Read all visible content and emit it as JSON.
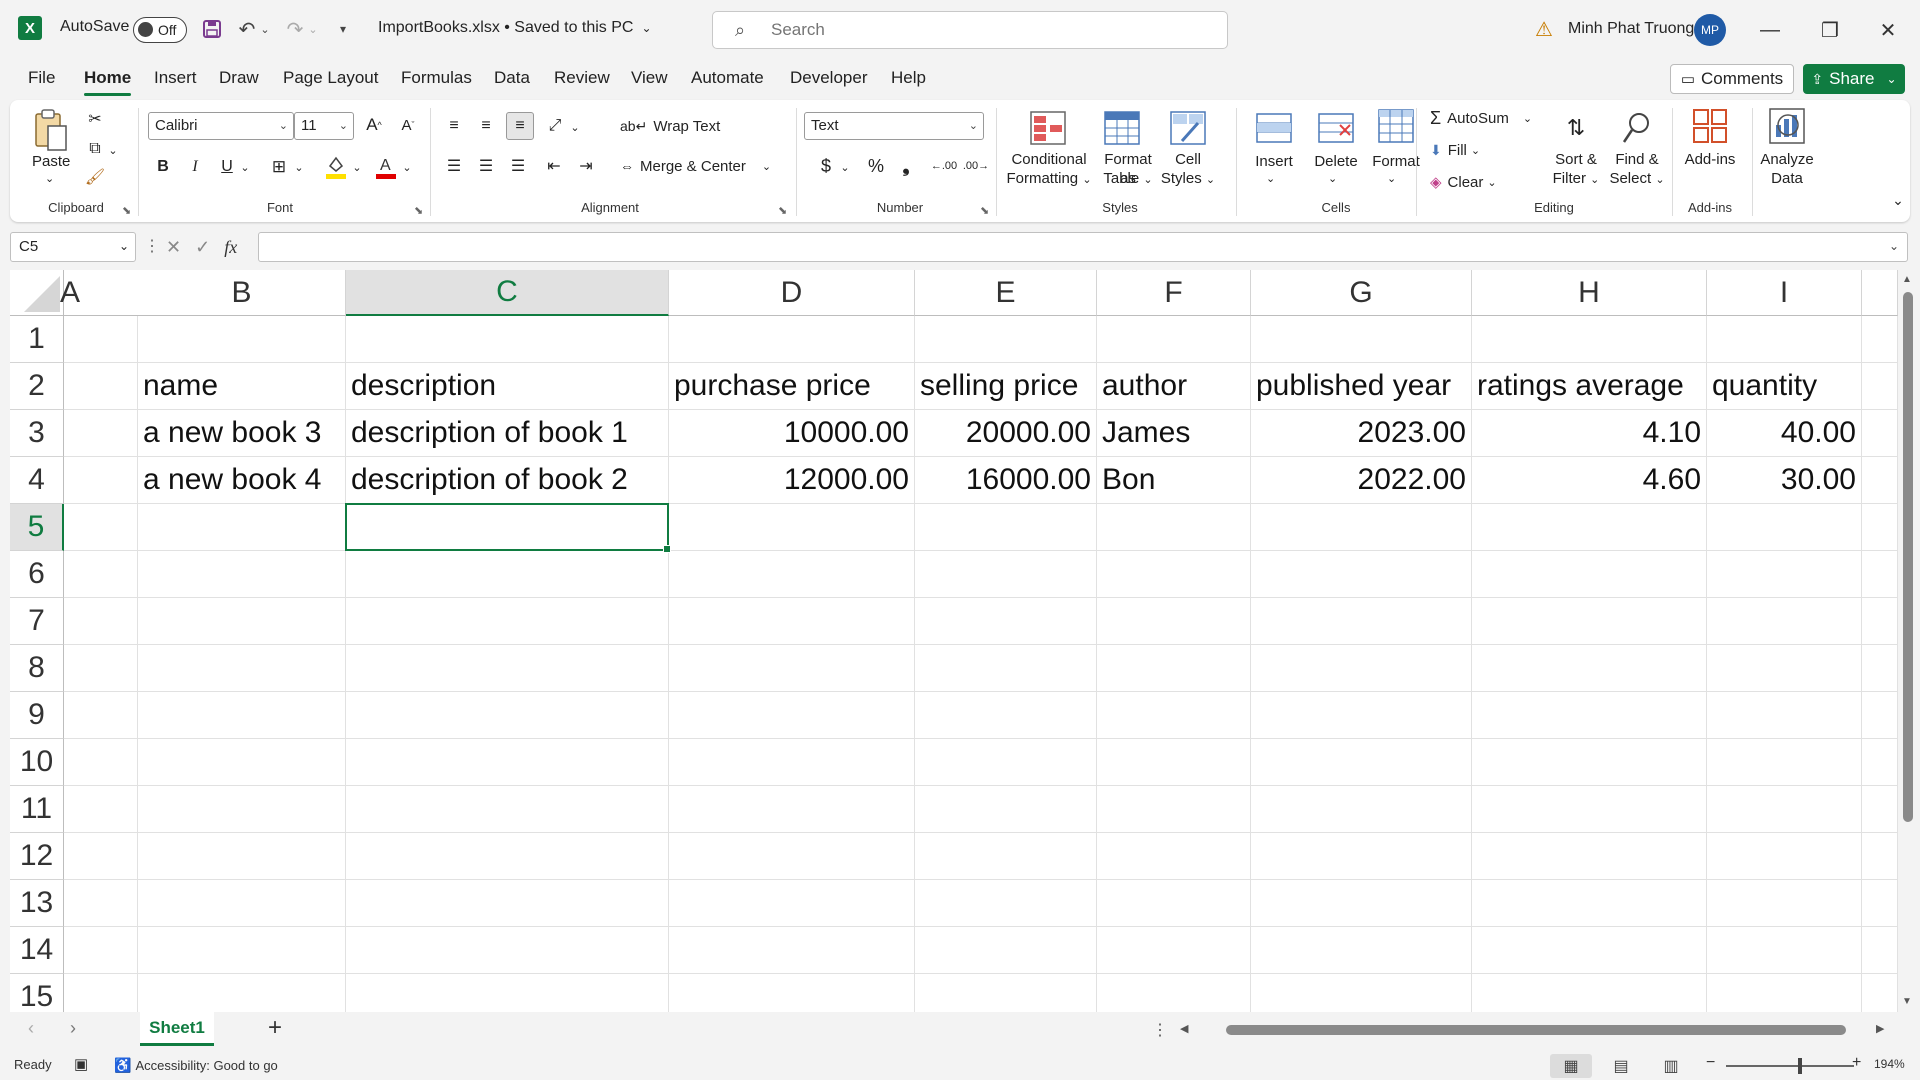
{
  "titlebar": {
    "autosave_label": "AutoSave",
    "autosave_state": "Off",
    "filename": "ImportBooks.xlsx • Saved to this PC",
    "search_placeholder": "Search",
    "user_name": "Minh Phat Truong",
    "user_initials": "MP"
  },
  "menu": {
    "tabs": [
      "File",
      "Home",
      "Insert",
      "Draw",
      "Page Layout",
      "Formulas",
      "Data",
      "Review",
      "View",
      "Automate",
      "Developer",
      "Help"
    ],
    "active": "Home",
    "comments": "Comments",
    "share": "Share"
  },
  "ribbon": {
    "groups": [
      "Clipboard",
      "Font",
      "Alignment",
      "Number",
      "Styles",
      "Cells",
      "Editing",
      "Add-ins"
    ],
    "paste": "Paste",
    "font_name": "Calibri",
    "font_size": "11",
    "wrap_text": "Wrap Text",
    "merge_center": "Merge & Center",
    "number_format": "Text",
    "conditional_formatting": [
      "Conditional",
      "Formatting"
    ],
    "format_as_table": [
      "Format as",
      "Table"
    ],
    "cell_styles": [
      "Cell",
      "Styles"
    ],
    "insert": "Insert",
    "delete": "Delete",
    "format": "Format",
    "autosum": "AutoSum",
    "fill": "Fill",
    "clear": "Clear",
    "sort_filter": [
      "Sort &",
      "Filter"
    ],
    "find_select": [
      "Find &",
      "Select"
    ],
    "addins": "Add-ins",
    "analyze_data": [
      "Analyze",
      "Data"
    ]
  },
  "formula_bar": {
    "name_box": "C5",
    "fx": "fx",
    "content": ""
  },
  "sheet": {
    "columns": [
      "A",
      "B",
      "C",
      "D",
      "E",
      "F",
      "G",
      "H",
      "I"
    ],
    "rows": [
      "1",
      "2",
      "3",
      "4",
      "5",
      "6",
      "7",
      "8",
      "9",
      "10",
      "11",
      "12",
      "13",
      "14",
      "15"
    ],
    "selected_cell": "C5",
    "header_row": [
      "name",
      "description",
      "purchase price",
      "selling price",
      "author",
      "published year",
      "ratings average",
      "quantity"
    ],
    "data_rows": [
      [
        "a new book 3",
        "description of book 1",
        "10000.00",
        "20000.00",
        "James",
        "2023.00",
        "4.10",
        "40.00"
      ],
      [
        "a new book 4",
        "description of book 2",
        "12000.00",
        "16000.00",
        "Bon",
        "2022.00",
        "4.60",
        "30.00"
      ]
    ]
  },
  "sheet_tabs": {
    "tabs": [
      "Sheet1"
    ],
    "add": "+"
  },
  "status": {
    "ready": "Ready",
    "accessibility": "Accessibility: Good to go",
    "zoom": "194%"
  }
}
